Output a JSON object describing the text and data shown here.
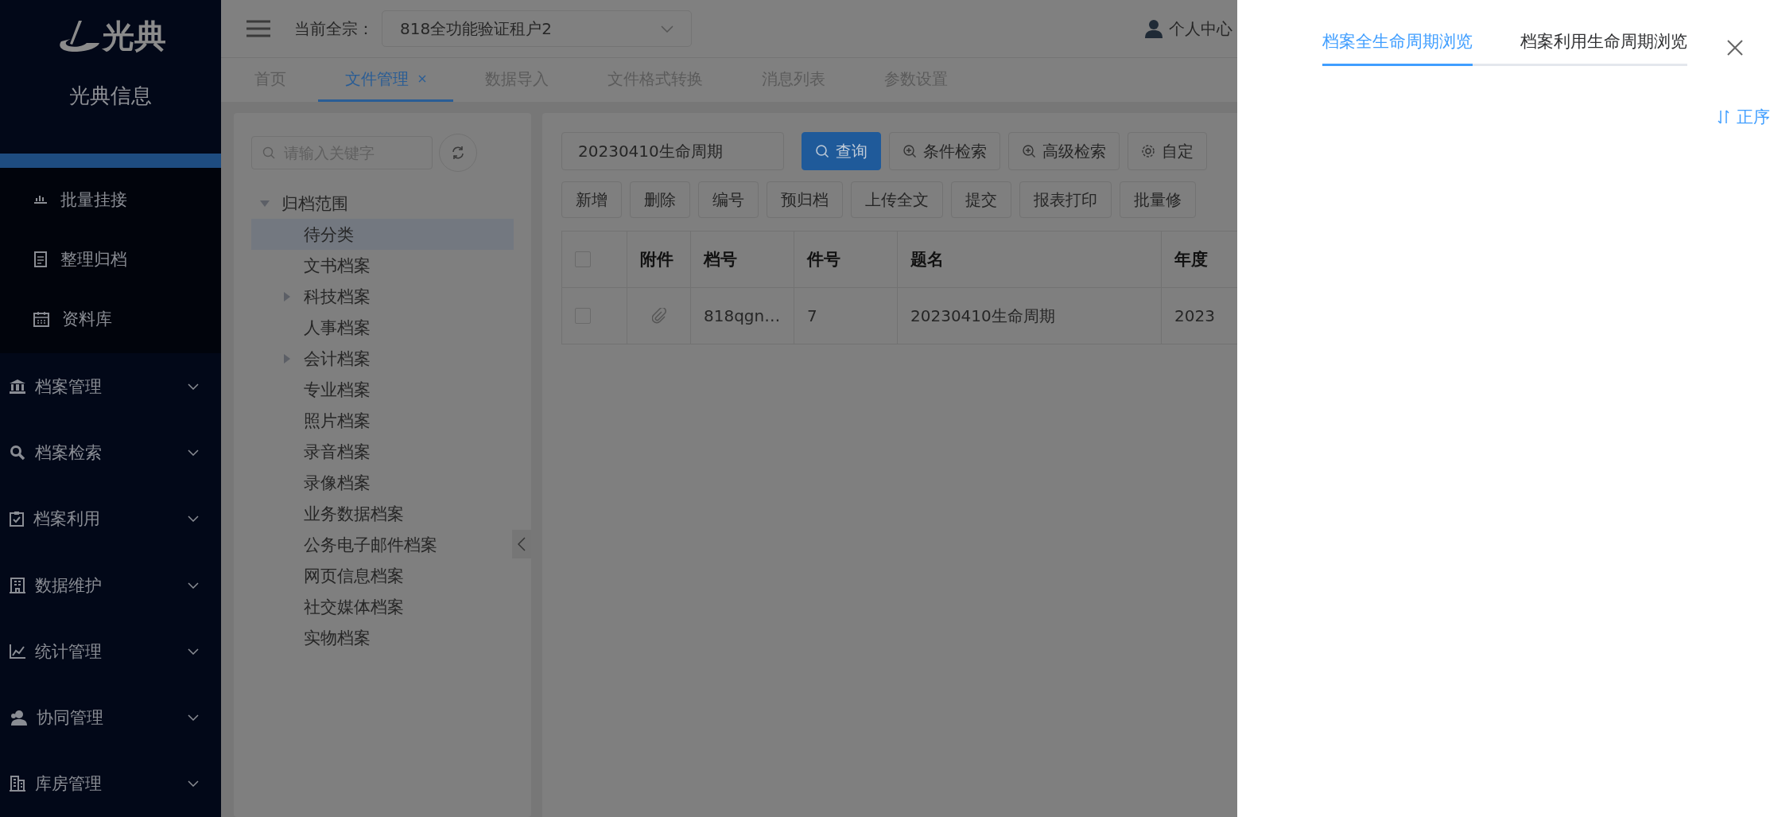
{
  "sidebar": {
    "logo": "光典",
    "brand": "光典信息",
    "submenu": [
      {
        "label": "批量挂接"
      },
      {
        "label": "整理归档"
      },
      {
        "label": "资料库"
      }
    ],
    "menu": [
      {
        "label": "档案管理",
        "expanded": false
      },
      {
        "label": "档案检索",
        "expanded": false
      },
      {
        "label": "档案利用",
        "expanded": false
      },
      {
        "label": "数据维护",
        "expanded": false
      },
      {
        "label": "统计管理",
        "expanded": false
      },
      {
        "label": "协同管理",
        "expanded": false
      },
      {
        "label": "库房管理",
        "expanded": false
      }
    ]
  },
  "header": {
    "fonds_label": "当前全宗：",
    "fonds_value": "818全功能验证租户2",
    "user": "个人中心"
  },
  "tabs": [
    {
      "label": "首页",
      "selected": false,
      "closable": false
    },
    {
      "label": "文件管理",
      "selected": true,
      "closable": true
    },
    {
      "label": "数据导入",
      "selected": false,
      "closable": false
    },
    {
      "label": "文件格式转换",
      "selected": false,
      "closable": false
    },
    {
      "label": "消息列表",
      "selected": false,
      "closable": false
    },
    {
      "label": "参数设置",
      "selected": false,
      "closable": false
    }
  ],
  "tree": {
    "search": {
      "placeholder": "请输入关键字"
    },
    "nodes": [
      {
        "label": "归档范围",
        "selected": false,
        "expanded": true,
        "children": [
          {
            "label": "待分类",
            "selected": true
          },
          {
            "label": "文书档案",
            "selected": false
          },
          {
            "label": "科技档案",
            "selected": false,
            "expanded": false
          },
          {
            "label": "人事档案",
            "selected": false
          },
          {
            "label": "会计档案",
            "selected": false,
            "expanded": false
          },
          {
            "label": "专业档案",
            "selected": false
          },
          {
            "label": "照片档案",
            "selected": false
          },
          {
            "label": "录音档案",
            "selected": false
          },
          {
            "label": "录像档案",
            "selected": false
          },
          {
            "label": "业务数据档案",
            "selected": false
          },
          {
            "label": "公务电子邮件档案",
            "selected": false
          },
          {
            "label": "网页信息档案",
            "selected": false
          },
          {
            "label": "社交媒体档案",
            "selected": false
          },
          {
            "label": "实物档案",
            "selected": false
          }
        ]
      }
    ]
  },
  "query": {
    "value": "20230410生命周期",
    "search_buttons": [
      {
        "label": "查询",
        "kind": "primary"
      },
      {
        "label": "条件检索",
        "kind": "plus"
      },
      {
        "label": "高级检索",
        "kind": "plus"
      },
      {
        "label": "自定",
        "kind": "gear"
      }
    ],
    "actions": [
      "新增",
      "删除",
      "编号",
      "预归档",
      "上传全文",
      "提交",
      "报表打印",
      "批量修"
    ]
  },
  "table": {
    "header_checked": false,
    "columns": [
      "",
      "附件",
      "档号",
      "件号",
      "题名",
      "年度"
    ],
    "rows": [
      {
        "checked": false,
        "attachment": true,
        "cells": [
          "",
          "",
          "818qgn…",
          "7",
          "20230410生命周期",
          "2023"
        ]
      }
    ]
  },
  "drawer": {
    "tabs": [
      {
        "label": "档案全生命周期浏览",
        "selected": true
      },
      {
        "label": "档案利用生命周期浏览",
        "selected": false
      }
    ],
    "sort": "正序"
  }
}
